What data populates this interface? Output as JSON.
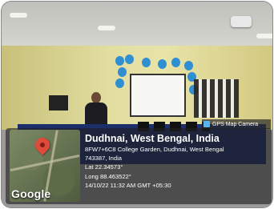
{
  "badge": {
    "label": "GPS Map Camera",
    "icon": "camera-app-icon"
  },
  "map": {
    "brand": "Google",
    "pin_icon": "location-pin-icon",
    "pin_color": "#e04a3a"
  },
  "location": {
    "title": "Dudhnai, West Bengal, India",
    "address_line1": "8FW7+6C8 College Garden, Dudhnai, West Bengal",
    "address_line2": "743387, India",
    "lat": "Lat 22.34573°",
    "long": "Long 88.463522°",
    "datetime": "14/10/22 11:32 AM GMT +05:30"
  }
}
